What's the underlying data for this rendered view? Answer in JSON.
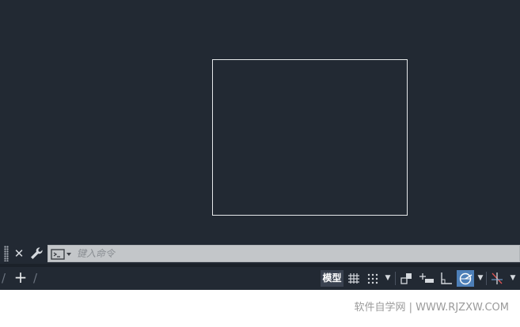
{
  "command_line": {
    "placeholder": "键入命令"
  },
  "status_bar": {
    "model_label": "模型"
  },
  "watermark": {
    "text": "软件自学网 | WWW.RJZXW.COM"
  },
  "icons": [
    "grip-handle-icon",
    "close-icon",
    "wrench-icon",
    "command-prompt-icon",
    "add-tab-icon",
    "grid-icon",
    "snap-icon",
    "infer-constraints-icon",
    "dynamic-input-icon",
    "ortho-icon",
    "polar-tracking-icon",
    "isometric-drafting-icon"
  ],
  "colors": {
    "canvas": "#222933",
    "command_input": "#c3c6c9",
    "active_toggle": "#4d7fb8",
    "drawn_line": "#e6e8ea"
  }
}
